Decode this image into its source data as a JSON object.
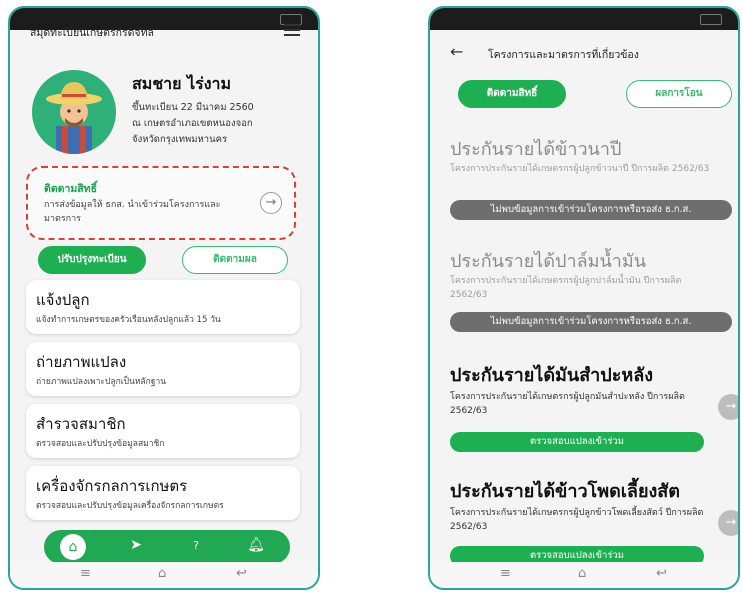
{
  "left": {
    "app_title": "สมุดทะเบียนเกษตรกรดิจิทัล",
    "profile": {
      "name": "สมชาย  ไร่งาม",
      "lines": [
        "ขึ้นทะเบียน 22 มีนาคม 2560",
        "ณ เกษตรอำเภอเขตหนองจอก",
        "จังหวัดกรุงเทพมหานคร"
      ]
    },
    "track_card": {
      "title": "ติดตามสิทธิ์",
      "desc": "การส่งข้อมูลให้ ธกส. นำเข้าร่วมโครงการและมาตรการ"
    },
    "buttons": {
      "update": "ปรับปรุงทะเบียน",
      "follow": "ติดตามผล"
    },
    "menu": [
      {
        "title": "แจ้งปลูก",
        "subtitle": "แจ้งทำการเกษตรของครัวเรือนหลังปลูกแล้ว 15 วัน"
      },
      {
        "title": "ถ่ายภาพแปลง",
        "subtitle": "ถ่ายภาพแปลงเพาะปลูกเป็นหลักฐาน"
      },
      {
        "title": "สำรวจสมาชิก",
        "subtitle": "ตรวจสอบและปรับปรุงข้อมูลสมาชิก"
      },
      {
        "title": "เครื่องจักรกลการเกษตร",
        "subtitle": "ตรวจสอบและปรับปรุงข้อมูลเครื่องจักรกลการเกษตร"
      }
    ],
    "bottom_nav": {
      "help": "?"
    }
  },
  "right": {
    "title": "โครงการและมาตรการที่เกี่ยวข้อง",
    "tabs": {
      "rights": "ติดตามสิทธิ์",
      "transfer": "ผลการโอน"
    },
    "sections": [
      {
        "title": "ประกันรายได้ข้าวนาปี",
        "desc": "โครงการประกันรายได้เกษตรกรผู้ปลูกข้าวนาปี ปีการผลิต 2562/63",
        "status": "ไม่พบข้อมูลการเข้าร่วมโครงการหรือรอส่ง ธ.ก.ส."
      },
      {
        "title": "ประกันรายได้ปาล์มน้ำมัน",
        "desc": "โครงการประกันรายได้เกษตรกรผู้ปลูกปาล์มน้ำมัน ปีการผลิต 2562/63",
        "status": "ไม่พบข้อมูลการเข้าร่วมโครงการหรือรอส่ง ธ.ก.ส."
      },
      {
        "title": "ประกันรายได้มันสำปะหลัง",
        "desc": "โครงการประกันรายได้เกษตรกรผู้ปลูกมันสำปะหลัง ปีการผลิต 2562/63",
        "action": "ตรวจสอบแปลงเข้าร่วม"
      },
      {
        "title": "ประกันรายได้ข้าวโพดเลี้ยงสัต",
        "desc": "โครงการประกันรายได้เกษตรกรผู้ปลูกข้าวโพดเลี้ยงสัตว์ ปีการผลิต 2562/63",
        "action": "ตรวจสอบแปลงเข้าร่วม"
      }
    ]
  },
  "colors": {
    "accent": "#1faf53",
    "frame": "#2aa59b",
    "alert": "#d9403a"
  }
}
